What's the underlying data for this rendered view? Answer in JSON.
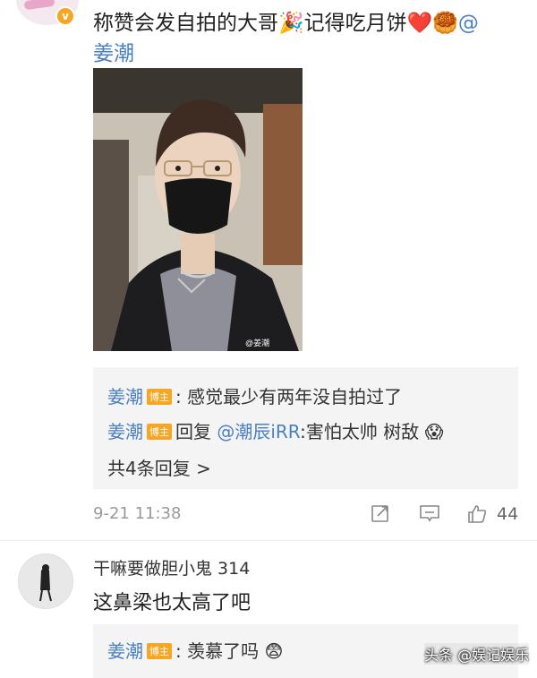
{
  "comment1": {
    "text_part1": "称赞会发自拍的大哥",
    "party_emoji": "🎉",
    "text_part2": "记得吃月饼",
    "heart_emoji": "❤️",
    "mooncake_emoji": "🥮",
    "at": "@",
    "mention": "姜潮"
  },
  "photo": {
    "watermark": "@姜潮"
  },
  "reply_box": {
    "reply1": {
      "user": "姜潮",
      "badge": "博主",
      "text": ": 感觉最少有两年没自拍过了"
    },
    "reply2": {
      "user": "姜潮",
      "badge": "博主",
      "reply_word": "回复",
      "mention": "@潮辰iRR",
      "text": ":害怕太帅 树敌",
      "emoji": "😱"
    },
    "more": "共4条回复 >"
  },
  "meta": {
    "time": "9-21 11:38",
    "like_count": "44"
  },
  "comment2": {
    "username": "干嘛要做胆小鬼 314",
    "text": "这鼻梁也太高了吧"
  },
  "reply_box2": {
    "user": "姜潮",
    "badge": "博主",
    "text": ": 羡慕了吗",
    "emoji": "😨"
  },
  "watermark": "头条 @娱记娱乐"
}
